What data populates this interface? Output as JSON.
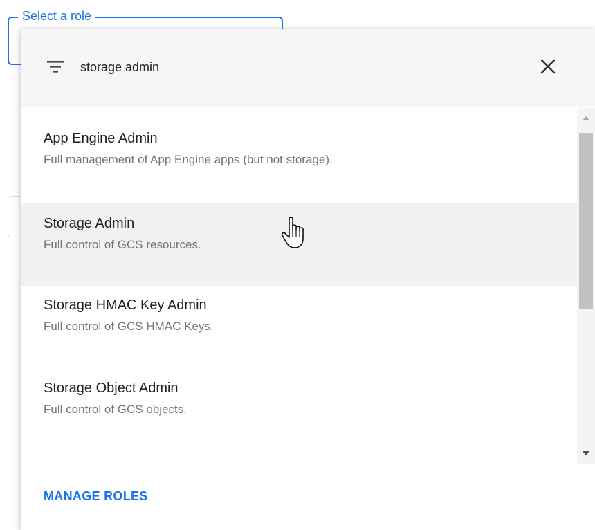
{
  "role_field": {
    "label": "Select a role"
  },
  "filter": {
    "icon": "filter-list-icon",
    "value": "storage admin",
    "clear_icon": "close-icon"
  },
  "roles": [
    {
      "title": "App Engine Admin",
      "description": "Full management of App Engine apps (but not storage)."
    },
    {
      "title": "Storage Admin",
      "description": "Full control of GCS resources."
    },
    {
      "title": "Storage HMAC Key Admin",
      "description": "Full control of GCS HMAC Keys."
    },
    {
      "title": "Storage Object Admin",
      "description": "Full control of GCS objects."
    }
  ],
  "footer": {
    "manage_roles_label": "MANAGE ROLES"
  },
  "colors": {
    "accent": "#1a73e8",
    "hover_row": "#f1f1f1",
    "filter_bar": "#f6f6f6"
  }
}
